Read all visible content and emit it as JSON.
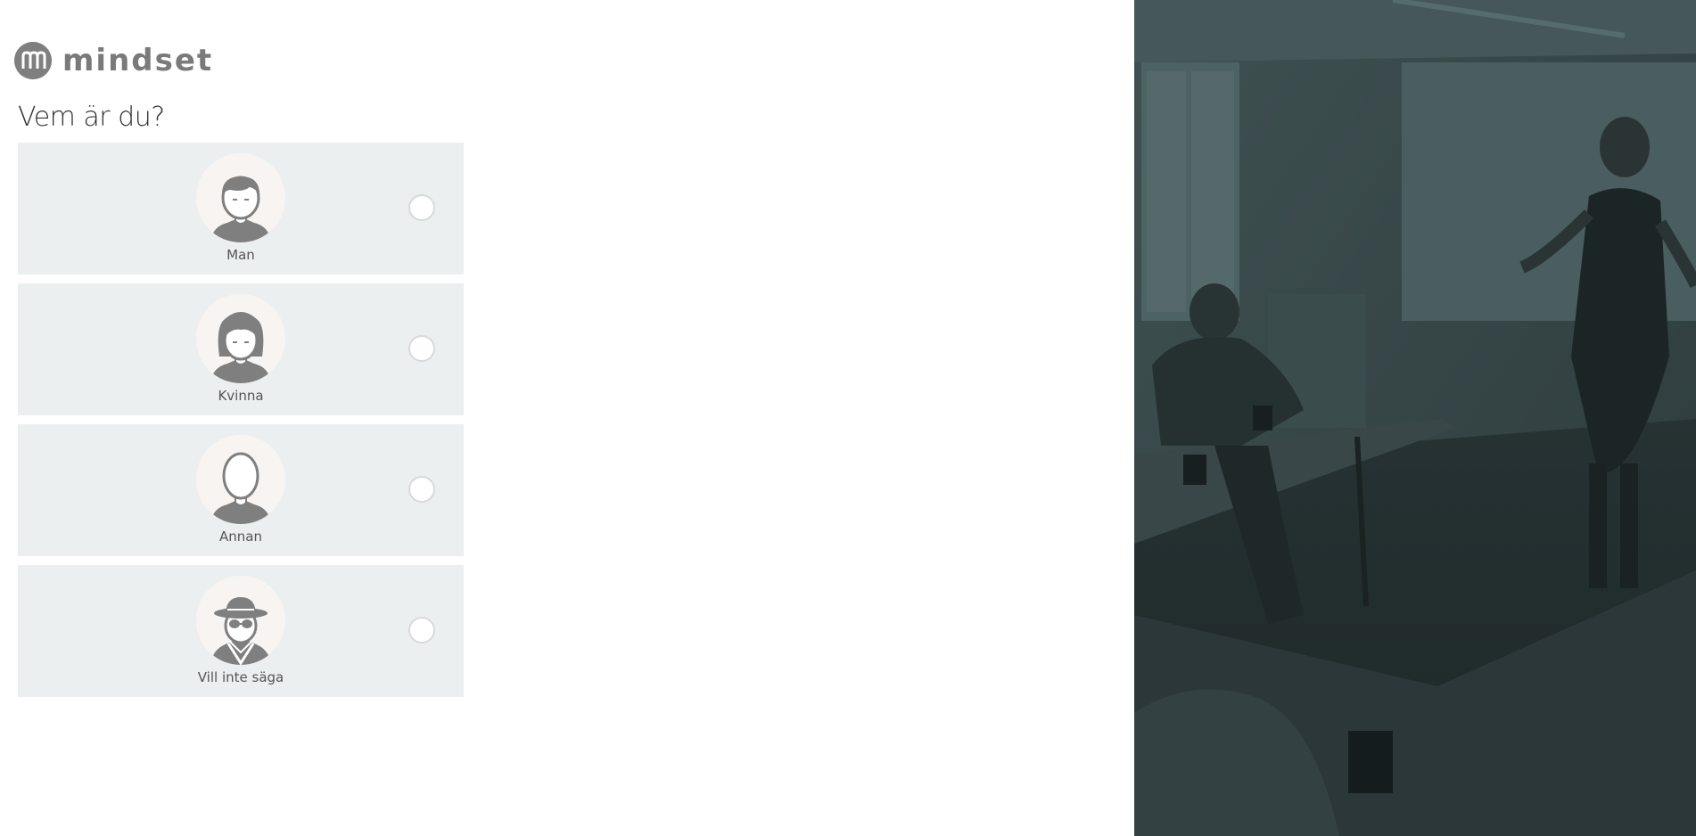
{
  "logo": {
    "text": "mindset"
  },
  "question": "Vem är du?",
  "options": [
    {
      "label": "Man",
      "icon": "man-avatar-icon",
      "selected": false
    },
    {
      "label": "Kvinna",
      "icon": "woman-avatar-icon",
      "selected": false
    },
    {
      "label": "Annan",
      "icon": "other-avatar-icon",
      "selected": false
    },
    {
      "label": "Vill inte säga",
      "icon": "spy-avatar-icon",
      "selected": false
    }
  ],
  "colors": {
    "option_background": "#ecefef",
    "avatar_background": "#f7f4f2",
    "icon_gray": "#7f7f7f",
    "photo_tint": "#2f3e3f"
  }
}
